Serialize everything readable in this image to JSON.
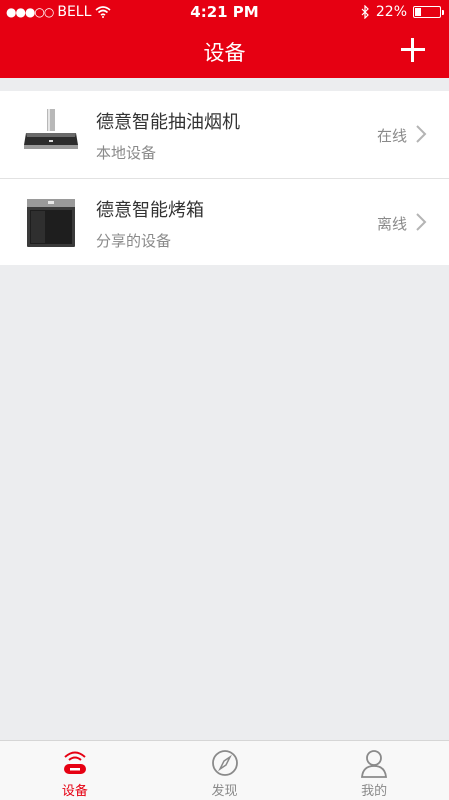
{
  "status_bar": {
    "carrier": "BELL",
    "time": "4:21 PM",
    "battery": "22%",
    "battery_level": 0.22,
    "signal_dots": "●●●○○"
  },
  "nav": {
    "title": "设备",
    "add_icon": "plus-icon"
  },
  "devices": [
    {
      "name": "德意智能抽油烟机",
      "subtitle": "本地设备",
      "status": "在线",
      "icon": "range-hood-image"
    },
    {
      "name": "德意智能烤箱",
      "subtitle": "分享的设备",
      "status": "离线",
      "icon": "oven-image"
    }
  ],
  "tabs": [
    {
      "label": "设备",
      "icon": "router-icon",
      "active": true
    },
    {
      "label": "发现",
      "icon": "compass-icon",
      "active": false
    },
    {
      "label": "我的",
      "icon": "user-icon",
      "active": false
    }
  ],
  "colors": {
    "brand": "#E60012",
    "background": "#ECEDEF",
    "text_secondary": "#8A8A8A"
  }
}
